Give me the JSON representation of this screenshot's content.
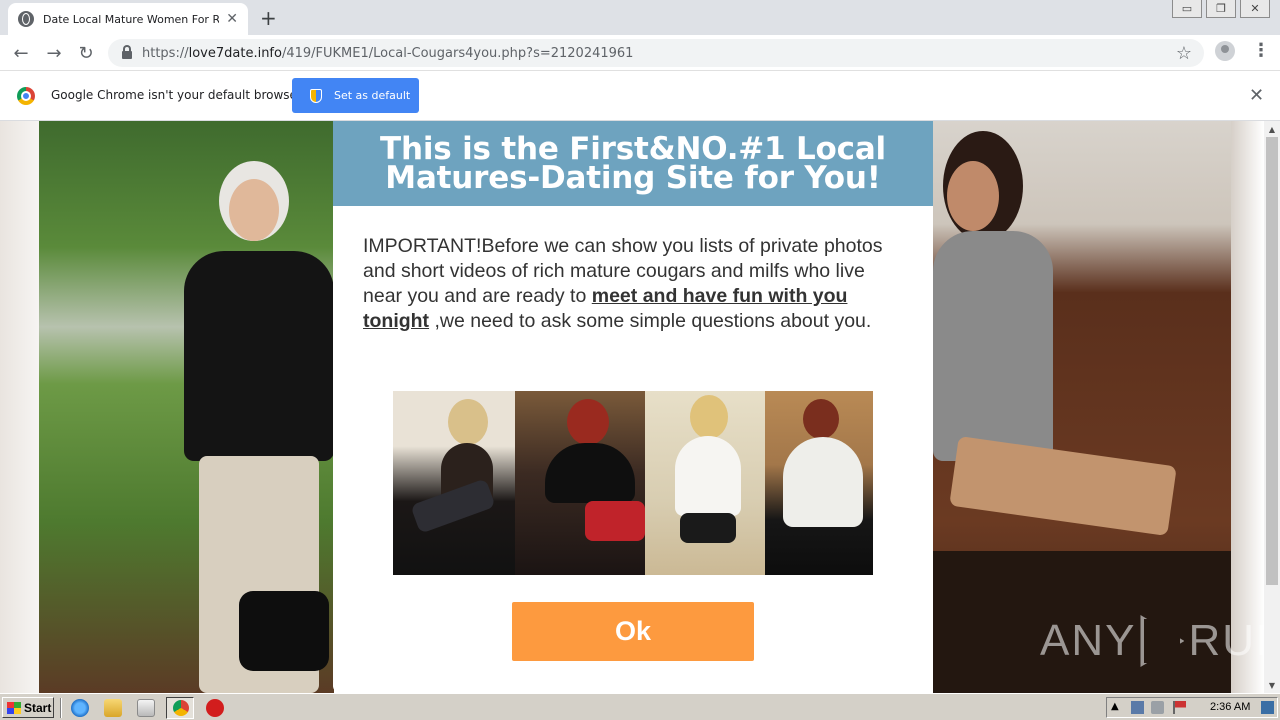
{
  "browser": {
    "tab_title": "Date Local Mature Women For Real I",
    "tab_close": "✕",
    "new_tab": "+",
    "url_prefix": "https://",
    "url_host": "love7date.info",
    "url_path": "/419/FUKME1/Local-Cougars4you.php?s=2120241961",
    "window_buttons": [
      "▭",
      "❐",
      "✕"
    ]
  },
  "infobar": {
    "message": "Google Chrome isn't your default browser",
    "button_label": "Set as default",
    "close": "✕"
  },
  "modal": {
    "title": "This is the First&NO.#1 Local Matures-Dating Site for You!",
    "body_before": "IMPORTANT!Before we can show you lists of private photos and short videos of rich mature cougars and milfs who live near you and are ready to ",
    "body_emphasis": "meet and have fun with you tonight",
    "body_after": " ,we need to ask some simple questions about you.",
    "ok_label": "Ok"
  },
  "watermark": {
    "left": "ANY",
    "right": "RUN"
  },
  "taskbar": {
    "start_label": "Start",
    "clock": "2:36 AM"
  },
  "colors": {
    "modal_header": "#6ea3bf",
    "ok_button": "#fd9a3f",
    "infobar_button": "#4285f4"
  }
}
